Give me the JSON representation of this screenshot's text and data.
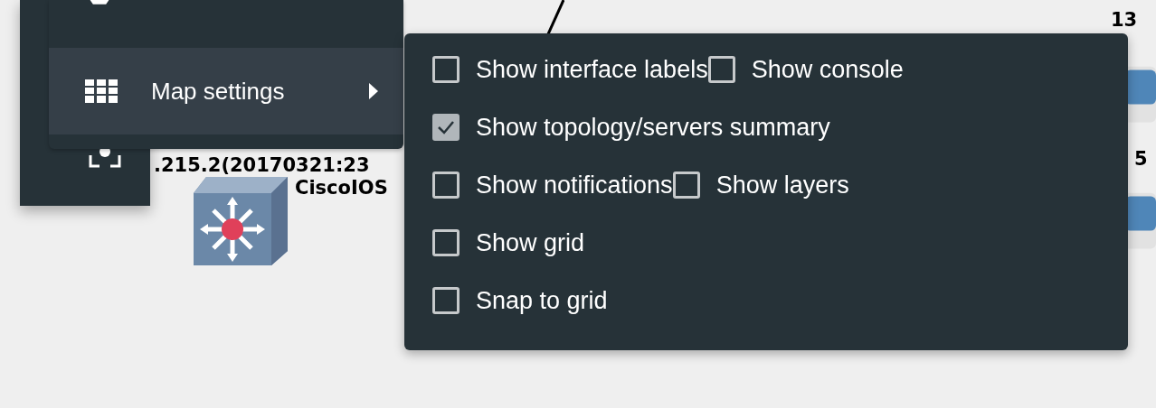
{
  "canvas": {
    "labels": [
      {
        "text": ".215.2(20170321:23",
        "kind": "node"
      },
      {
        "text": "CiscoIOS",
        "kind": "node"
      },
      {
        "text": "13",
        "kind": "node"
      },
      {
        "text": "5",
        "kind": "node"
      }
    ]
  },
  "menu": {
    "items": [
      {
        "label": "Map settings",
        "selected": true
      }
    ]
  },
  "submenu": {
    "rows": [
      [
        {
          "label": "Show interface labels",
          "checked": false
        },
        {
          "label": "Show console",
          "checked": false
        }
      ],
      [
        {
          "label": "Show topology/servers summary",
          "checked": true
        }
      ],
      [
        {
          "label": "Show notifications",
          "checked": false
        },
        {
          "label": "Show layers",
          "checked": false
        }
      ],
      [
        {
          "label": "Show grid",
          "checked": false
        }
      ],
      [
        {
          "label": "Snap to grid",
          "checked": false
        }
      ]
    ]
  }
}
